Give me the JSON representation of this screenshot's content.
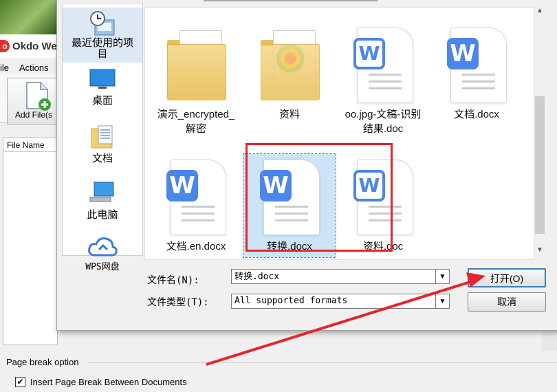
{
  "background_app": {
    "title": "Okdo We",
    "menu": {
      "file": "ile",
      "actions": "Actions"
    },
    "toolbar": {
      "add_files": "Add File(s"
    },
    "file_list": {
      "column_file_name": "File Name"
    },
    "page_break": {
      "group_label": "Page break option",
      "checkbox_label": "Insert Page Break Between Documents",
      "checked": true
    }
  },
  "dialog": {
    "places": [
      {
        "label": "最近使用的项目",
        "icon": "recent-items-icon"
      },
      {
        "label": "桌面",
        "icon": "desktop-icon"
      },
      {
        "label": "文档",
        "icon": "documents-icon"
      },
      {
        "label": "此电脑",
        "icon": "this-pc-icon"
      },
      {
        "label": "WPS网盘",
        "icon": "wps-cloud-icon"
      }
    ],
    "files": [
      {
        "name_line1": "演示_encrypted_",
        "name_line2": "解密",
        "type": "folder"
      },
      {
        "name_line1": "资料",
        "name_line2": "",
        "type": "folder"
      },
      {
        "name_line1": "oo.jpg-文稿-识别",
        "name_line2": "结果.doc",
        "type": "word-outline"
      },
      {
        "name_line1": "文档.docx",
        "name_line2": "",
        "type": "word"
      },
      {
        "name_line1": "文档.en.docx",
        "name_line2": "",
        "type": "word"
      },
      {
        "name_line1": "转换.docx",
        "name_line2": "",
        "type": "word",
        "selected": true
      },
      {
        "name_line1": "资料.doc",
        "name_line2": "",
        "type": "word-outline"
      }
    ],
    "filename_label": "文件名(N):",
    "filename_value": "转换.docx",
    "filetype_label": "文件类型(T):",
    "filetype_value": "All supported formats",
    "open_button": "打开(O)",
    "cancel_button": "取消"
  },
  "colors": {
    "accent": "#4b86e8",
    "annotation_red": "#e3262b",
    "selection": "#cce4f7"
  }
}
